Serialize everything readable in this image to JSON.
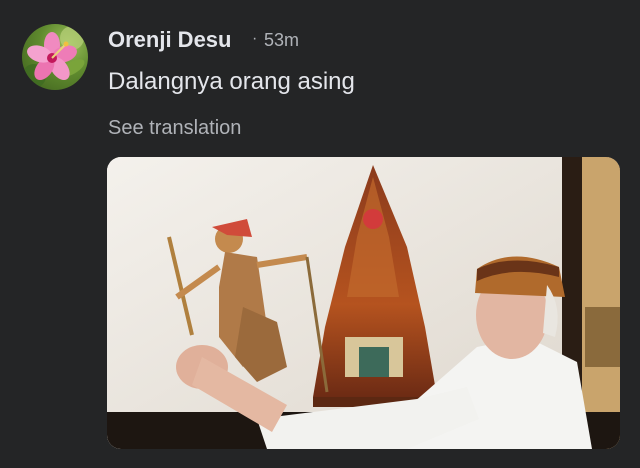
{
  "post": {
    "author": "Orenji Desu",
    "separator": "·",
    "timestamp": "53m",
    "message": "Dalangnya orang asing",
    "see_translation": "See translation"
  },
  "icons": {
    "avatar": "hibiscus-flower-avatar"
  },
  "colors": {
    "background": "#242526",
    "primary_text": "#e4e6eb",
    "secondary_text": "#b0b3b8"
  }
}
